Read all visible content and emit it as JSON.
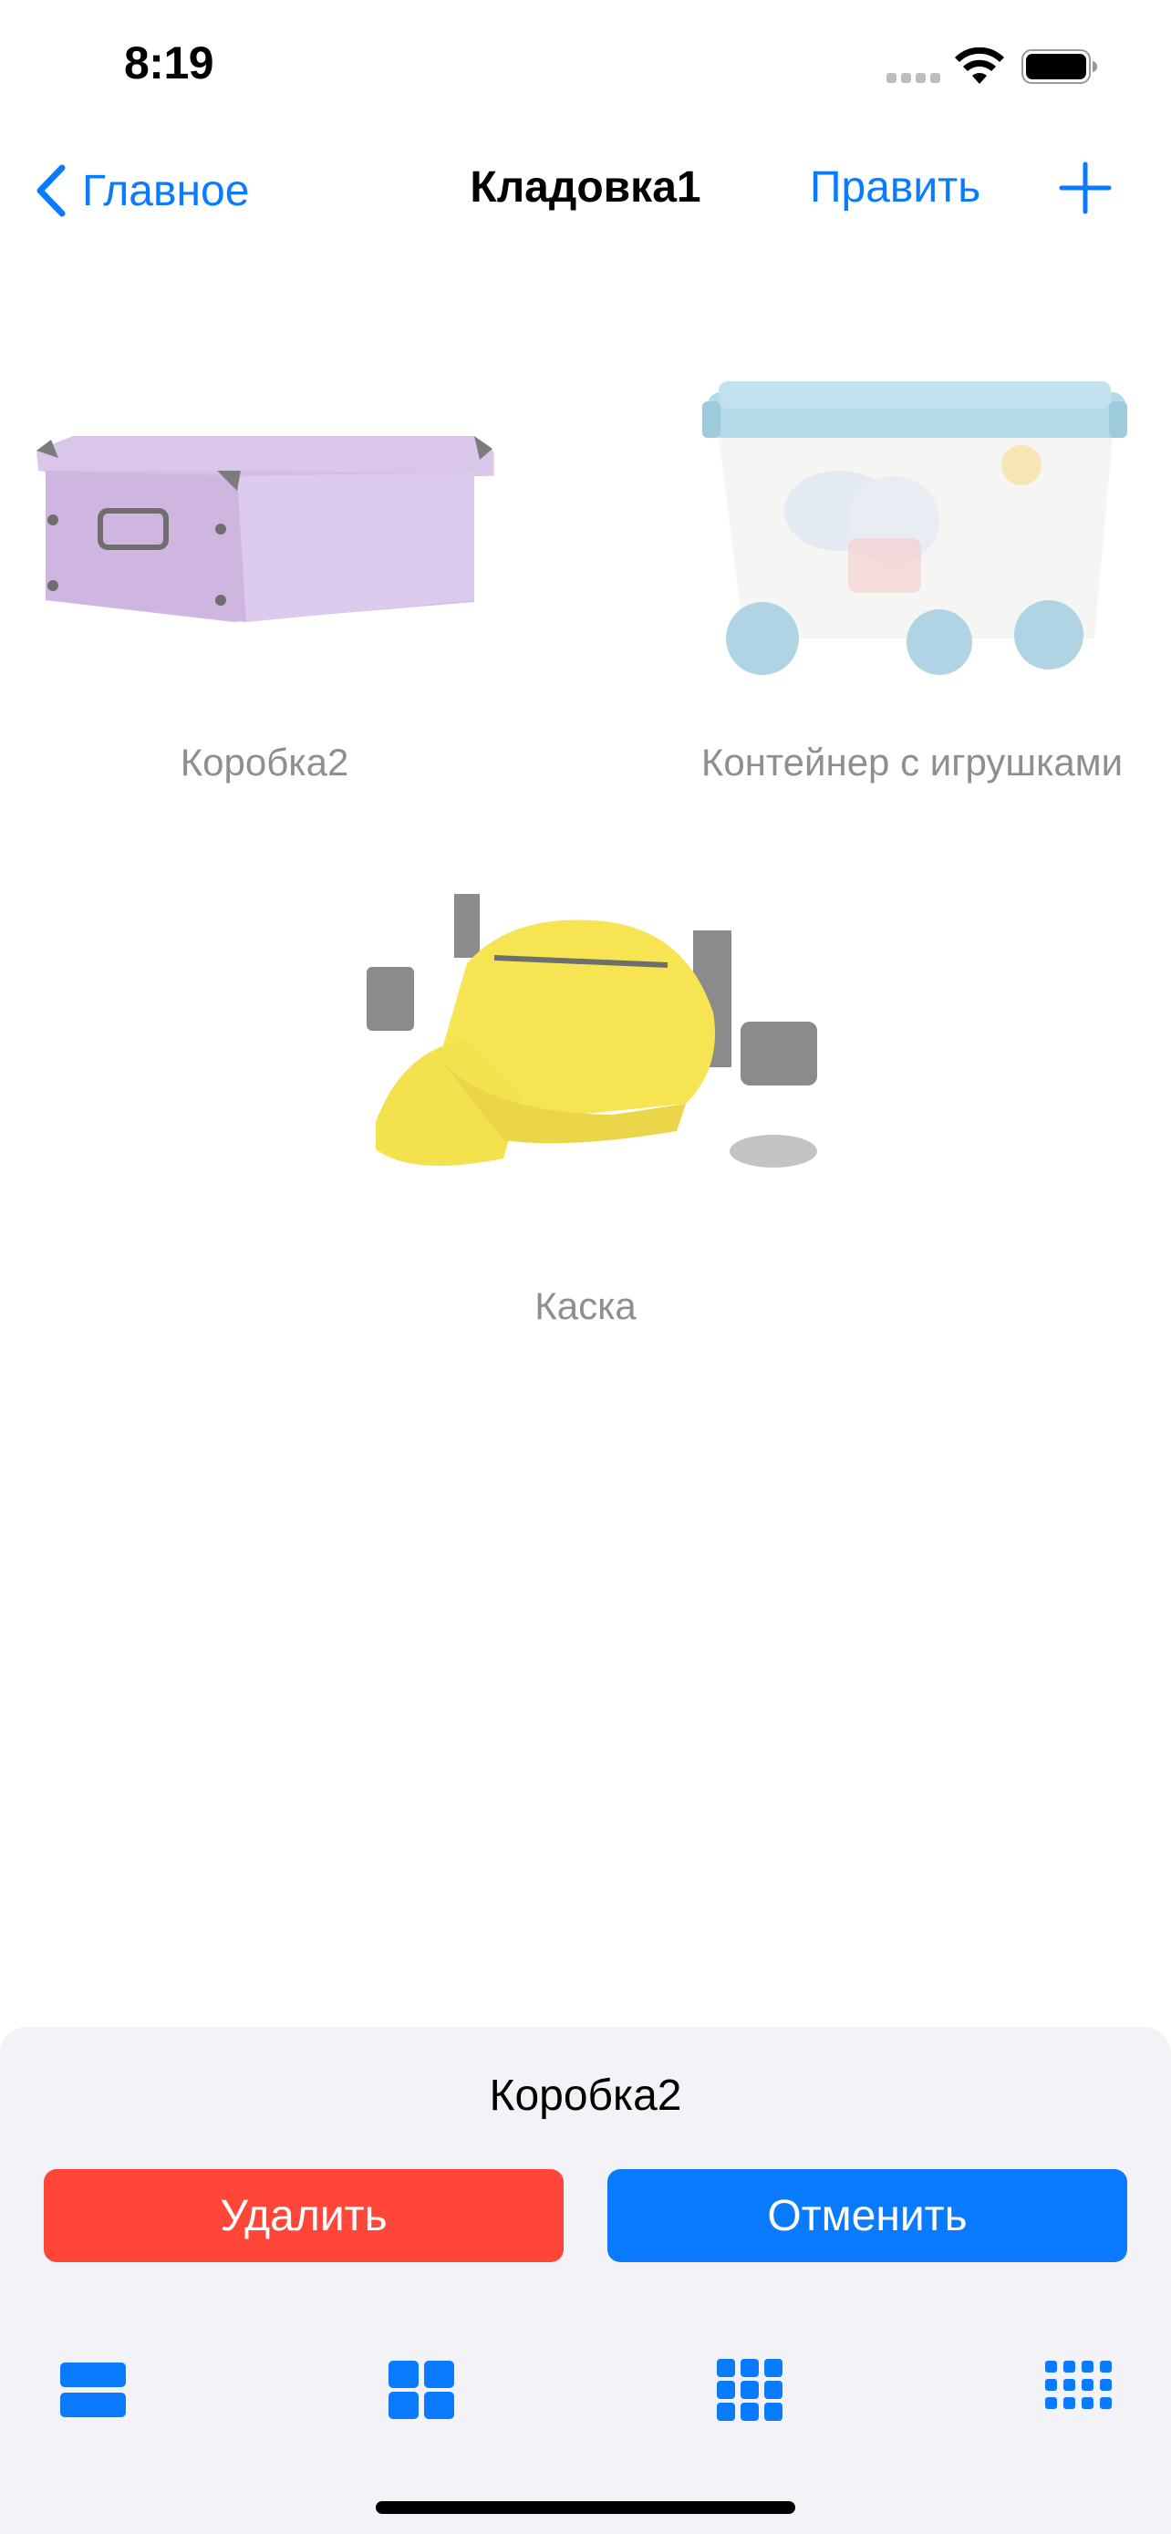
{
  "status_bar": {
    "time": "8:19",
    "icons": [
      "cellular-signal-icon",
      "wifi-icon",
      "battery-icon"
    ]
  },
  "nav": {
    "back_label": "Главное",
    "title": "Кладовка1",
    "edit_label": "Править",
    "add_icon": "plus-icon"
  },
  "items": [
    {
      "label": "Коробка2",
      "image": "purple-storage-box"
    },
    {
      "label": "Контейнер с игрушками",
      "image": "toy-container-on-wheels"
    },
    {
      "label": "Каска",
      "image": "yellow-drinking-helmet"
    }
  ],
  "sheet": {
    "title": "Коробка2",
    "delete_label": "Удалить",
    "cancel_label": "Отменить",
    "layout_icons": [
      "layout-1-column-icon",
      "layout-2-columns-icon",
      "layout-3-columns-icon",
      "layout-4-columns-icon"
    ]
  },
  "colors": {
    "accent": "#0a7aff",
    "destructive": "#ff4638",
    "sheet_background": "#f2f2f7",
    "label_gray": "#8a8a8e"
  }
}
